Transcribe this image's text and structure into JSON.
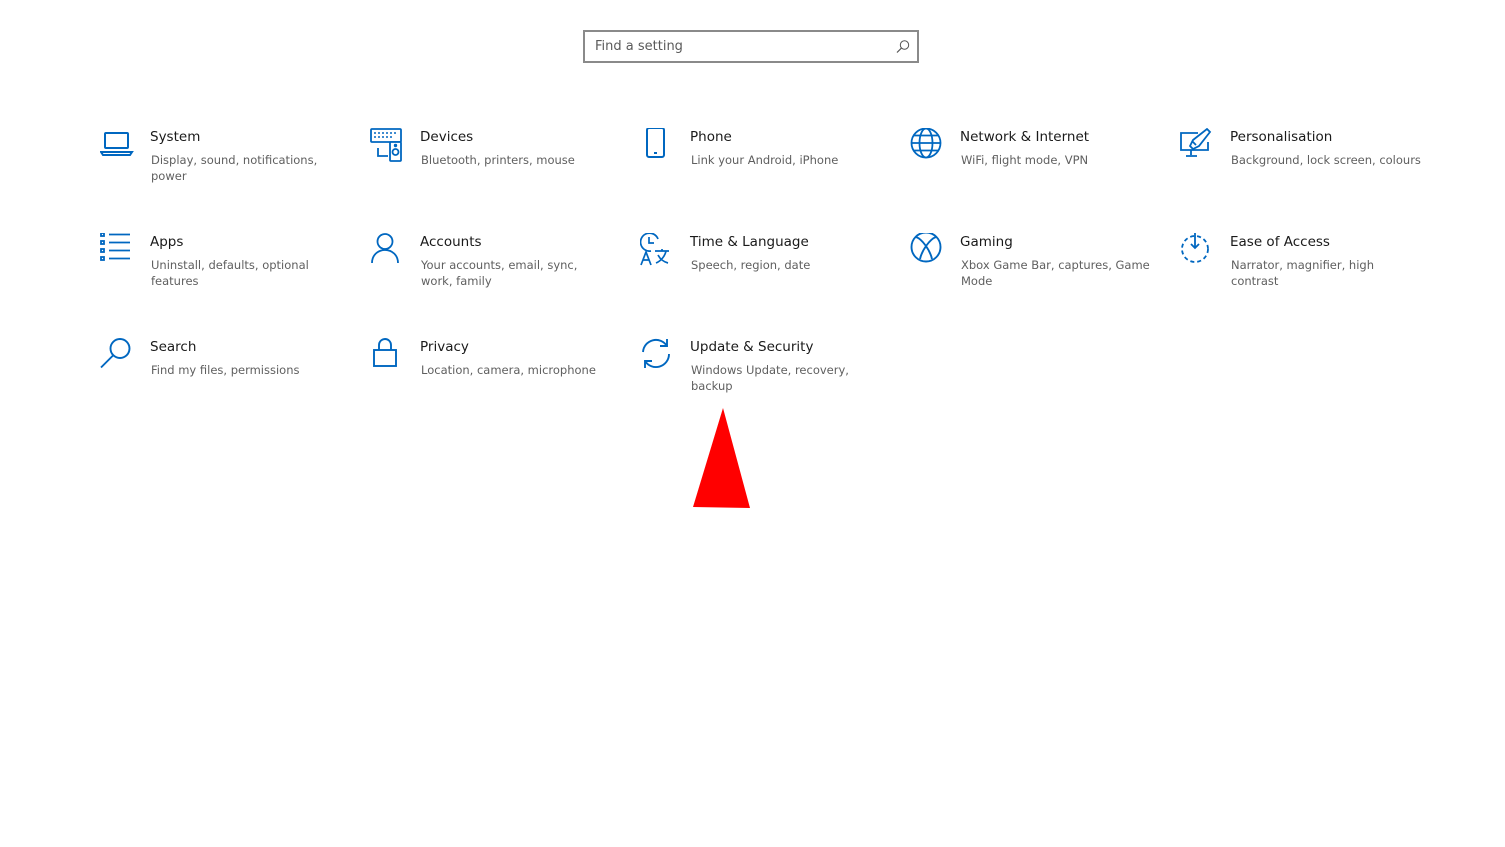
{
  "search": {
    "placeholder": "Find a setting"
  },
  "accent_color": "#0067c0",
  "marker_color": "#ff0000",
  "categories": [
    {
      "key": "system",
      "title": "System",
      "description": "Display, sound, notifications, power",
      "icon": "laptop-icon"
    },
    {
      "key": "devices",
      "title": "Devices",
      "description": "Bluetooth, printers, mouse",
      "icon": "keyboard-speaker-icon"
    },
    {
      "key": "phone",
      "title": "Phone",
      "description": "Link your Android, iPhone",
      "icon": "phone-icon"
    },
    {
      "key": "network",
      "title": "Network & Internet",
      "description": "WiFi, flight mode, VPN",
      "icon": "globe-icon"
    },
    {
      "key": "personalisation",
      "title": "Personalisation",
      "description": "Background, lock screen, colours",
      "icon": "paint-monitor-icon"
    },
    {
      "key": "apps",
      "title": "Apps",
      "description": "Uninstall, defaults, optional features",
      "icon": "app-list-icon"
    },
    {
      "key": "accounts",
      "title": "Accounts",
      "description": "Your accounts, email, sync, work, family",
      "icon": "person-icon"
    },
    {
      "key": "time-language",
      "title": "Time & Language",
      "description": "Speech, region, date",
      "icon": "clock-language-icon"
    },
    {
      "key": "gaming",
      "title": "Gaming",
      "description": "Xbox Game Bar, captures, Game Mode",
      "icon": "xbox-icon"
    },
    {
      "key": "ease-of-access",
      "title": "Ease of Access",
      "description": "Narrator, magnifier, high contrast",
      "icon": "ease-of-access-icon"
    },
    {
      "key": "search",
      "title": "Search",
      "description": "Find my files, permissions",
      "icon": "magnifier-icon"
    },
    {
      "key": "privacy",
      "title": "Privacy",
      "description": "Location, camera, microphone",
      "icon": "lock-icon"
    },
    {
      "key": "update-security",
      "title": "Update & Security",
      "description": "Windows Update, recovery, backup",
      "icon": "sync-arrows-icon"
    }
  ]
}
